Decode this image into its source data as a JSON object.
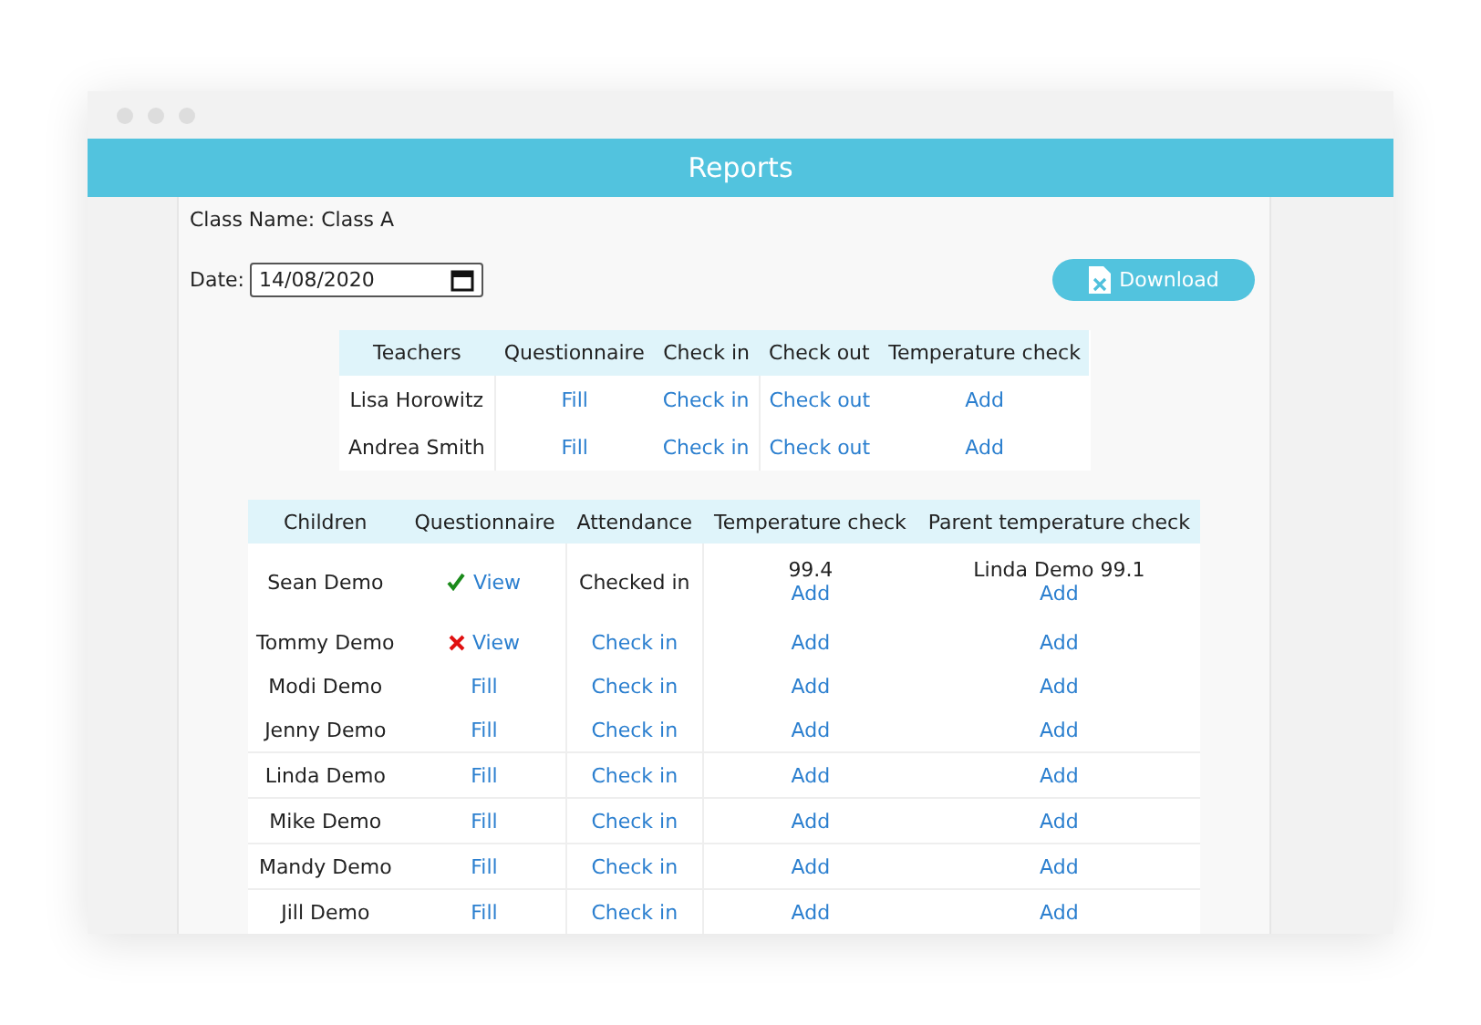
{
  "window": {
    "title": "Reports"
  },
  "class_name": "Class Name: Class A",
  "date": {
    "label": "Date:",
    "value": "14/08/2020"
  },
  "download_button": "Download",
  "teachers": {
    "columns": [
      "Teachers",
      "Questionnaire",
      "Check in",
      "Check out",
      "Temperature check"
    ],
    "rows": [
      {
        "name": "Lisa Horowitz",
        "questionnaire": "Fill",
        "check_in": "Check in",
        "check_out": "Check out",
        "temperature": "Add"
      },
      {
        "name": "Andrea Smith",
        "questionnaire": "Fill",
        "check_in": "Check in",
        "check_out": "Check out",
        "temperature": "Add"
      }
    ]
  },
  "children": {
    "columns": [
      "Children",
      "Questionnaire",
      "Attendance",
      "Temperature check",
      "Parent temperature check"
    ],
    "rows": [
      {
        "name": "Sean Demo",
        "questionnaire": {
          "kind": "view",
          "passed": true,
          "label": "View"
        },
        "attendance": {
          "kind": "text",
          "label": "Checked in"
        },
        "temperature": {
          "reading": "99.4",
          "action": "Add"
        },
        "parent_temperature": {
          "reading": "Linda Demo 99.1",
          "action": "Add"
        }
      },
      {
        "name": "Tommy Demo",
        "questionnaire": {
          "kind": "view",
          "passed": false,
          "label": "View"
        },
        "attendance": {
          "kind": "link",
          "label": "Check in"
        },
        "temperature": {
          "action": "Add"
        },
        "parent_temperature": {
          "action": "Add"
        }
      },
      {
        "name": "Modi Demo",
        "questionnaire": {
          "kind": "fill",
          "label": "Fill"
        },
        "attendance": {
          "kind": "link",
          "label": "Check in"
        },
        "temperature": {
          "action": "Add"
        },
        "parent_temperature": {
          "action": "Add"
        }
      },
      {
        "name": "Jenny Demo",
        "questionnaire": {
          "kind": "fill",
          "label": "Fill"
        },
        "attendance": {
          "kind": "link",
          "label": "Check in"
        },
        "temperature": {
          "action": "Add"
        },
        "parent_temperature": {
          "action": "Add"
        }
      },
      {
        "name": "Linda Demo",
        "questionnaire": {
          "kind": "fill",
          "label": "Fill"
        },
        "attendance": {
          "kind": "link",
          "label": "Check in"
        },
        "temperature": {
          "action": "Add"
        },
        "parent_temperature": {
          "action": "Add"
        }
      },
      {
        "name": "Mike Demo",
        "questionnaire": {
          "kind": "fill",
          "label": "Fill"
        },
        "attendance": {
          "kind": "link",
          "label": "Check in"
        },
        "temperature": {
          "action": "Add"
        },
        "parent_temperature": {
          "action": "Add"
        }
      },
      {
        "name": "Mandy Demo",
        "questionnaire": {
          "kind": "fill",
          "label": "Fill"
        },
        "attendance": {
          "kind": "link",
          "label": "Check in"
        },
        "temperature": {
          "action": "Add"
        },
        "parent_temperature": {
          "action": "Add"
        }
      },
      {
        "name": "Jill Demo",
        "questionnaire": {
          "kind": "fill",
          "label": "Fill"
        },
        "attendance": {
          "kind": "link",
          "label": "Check in"
        },
        "temperature": {
          "action": "Add"
        },
        "parent_temperature": {
          "action": "Add"
        }
      }
    ]
  }
}
